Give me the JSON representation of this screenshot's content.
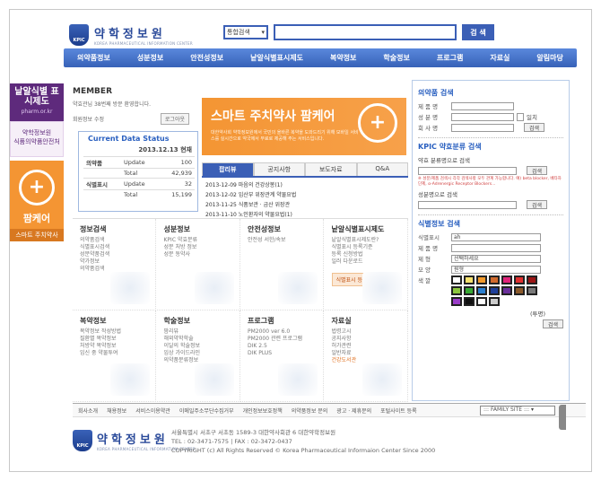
{
  "header": {
    "logo_kor": "약학정보원",
    "logo_eng": "KOREA PHARMACEUTICAL INFORMATION CENTER",
    "logo_badge": "KPIC",
    "search_select": "통합검색",
    "search_button": "검 색"
  },
  "gnb": [
    "의약품정보",
    "성분정보",
    "안전성정보",
    "낱알식별표시제도",
    "복약정보",
    "학술정보",
    "프로그램",
    "자료실",
    "알림마당"
  ],
  "left_banner": {
    "b1_title": "낱알식별 표시제도",
    "b1_sub": "pharm.or.kr",
    "b2_line1": "약학정보원",
    "b2_line2": "식품의약품안전처",
    "b3_icon": "+",
    "b3_title": "팜케어",
    "b3_sub": "스마트 주치약사"
  },
  "member": {
    "title": "MEMBER",
    "welcome": "약효관님 38번째 방문 환영합니다.",
    "level": "회원정보 수정",
    "logout": "로그아웃"
  },
  "data_status": {
    "title": "Current Data Status",
    "date": "2013.12.13 현재",
    "rows": [
      {
        "group": "의약품",
        "label": "Update",
        "value": "100"
      },
      {
        "group": "",
        "label": "Total",
        "value": "42,939"
      },
      {
        "group": "식별표시",
        "label": "Update",
        "value": "32"
      },
      {
        "group": "",
        "label": "Total",
        "value": "15,199"
      }
    ]
  },
  "promo": {
    "title": "스마트 주치약사  팜케어",
    "desc": "대한약사회 약학정보원에서 국민의 올바른 복약을 도와드리기 위해 모바일 서비스를 실시간으로 약국에서 무료로 제공해 주는 서비스입니다.",
    "icon": "+"
  },
  "notice": {
    "tabs": [
      "팝리뷰",
      "공지사항",
      "보도자료",
      "Q&A"
    ],
    "items": [
      "2013-12-09 마음의 건강상봉(1)",
      "2013-12-02 임산부 위장관계 약물요법",
      "2013-11-25 식품보관 · 금산 위장관",
      "2013-11-10 노인환자의 약물요법(1)"
    ]
  },
  "categories": [
    {
      "title": "정보검색",
      "items": [
        "의약품검색",
        "식별표시검색",
        "성분약품검색",
        "약가정보",
        "의약품검색"
      ],
      "hot": ""
    },
    {
      "title": "성분정보",
      "items": [
        "KPIC 약효분류",
        "성분 처방 정보",
        "성분 동약사"
      ],
      "hot": ""
    },
    {
      "title": "안전성정보",
      "items": [
        "안전성 서한/속보"
      ],
      "hot": ""
    },
    {
      "title": "낱알식별표시제도",
      "items": [
        "낱알식별표시제도란?",
        "식별표시 등록기준",
        "등록 신청방법",
        "일러 다운로드"
      ],
      "hot": "",
      "button": "식별표시 등록 바로가기"
    },
    {
      "title": "복약정보",
      "items": [
        "복약정보 작성방법",
        "질환별 복약정보",
        "처방약 복약정보",
        "임신 중 약물투여"
      ],
      "hot": ""
    },
    {
      "title": "학술정보",
      "items": [
        "팜리뷰",
        "해외약학학술",
        "이달의 학술정보",
        "임상 가이드라인",
        "의약품분류정보"
      ],
      "hot": ""
    },
    {
      "title": "프로그램",
      "items": [
        "PM2000 ver 6.0",
        "PM2000 관련 프로그램",
        "DIK 2.5",
        "DIK PLUS"
      ],
      "hot": ""
    },
    {
      "title": "자료실",
      "items": [
        "법령고시",
        "공지사항",
        "허가관련",
        "일반자료"
      ],
      "hot": "건강도서관"
    }
  ],
  "side": {
    "drug_search": {
      "title": "의약품 검색",
      "fields": [
        "제 품 명",
        "성 분 명",
        "회 사 명"
      ],
      "checkbox": "일치",
      "button": "검색"
    },
    "kpic": {
      "title": "KPIC 약효분류 검색",
      "sub1": "약효 분류명으로 검색",
      "note": "※ 성분/제품 검색시 각각 검색사항 모두 관계 가능합니다. 예) beta blocker, 베타차단제, α-Adrenergic Receptor Blockers...",
      "sub2": "성분명으로 검색",
      "button": "검색"
    },
    "id_search": {
      "title": "식별정보 검색",
      "labels": [
        "식별표시",
        "제 품 명",
        "제    형",
        "모    양",
        "색    깔"
      ],
      "id_value": "ah",
      "shape_value": "선택하세요",
      "type_value": "원형",
      "extra": "(투명)",
      "button": "검색",
      "colors": [
        "#ffffff",
        "#f5e16e",
        "#f39a2c",
        "#d06a2e",
        "#e0247a",
        "#e03030",
        "#9c1616",
        "#8cc63f",
        "#3aaa35",
        "#2a7fd0",
        "#1e3f99",
        "#6a2f9a",
        "#8b5a2b",
        "#7a7a7a",
        "#9a3cc8",
        "#111111",
        "#ffffff",
        "#cccccc"
      ]
    }
  },
  "footnav": [
    "회사소개",
    "채용정보",
    "서비스이용약관",
    "이메일주소무단수집거부",
    "개인정보보호정책",
    "의약품정보 문의",
    "광고 · 제휴문의",
    "포털사이트 등록"
  ],
  "family_site": "::: FAMILY SITE :::",
  "footer": {
    "address": "서울특별시 서초구 서초동 1589-3 대한약사회관 6 대한약학정보원",
    "tel": "TEL : 02-3471-7575  |  FAX : 02-3472-0437",
    "copyright": "COPYRIGHT (c) All Rights Reserved © Korea Pharmaceutical Informaion Center Since 2000"
  }
}
